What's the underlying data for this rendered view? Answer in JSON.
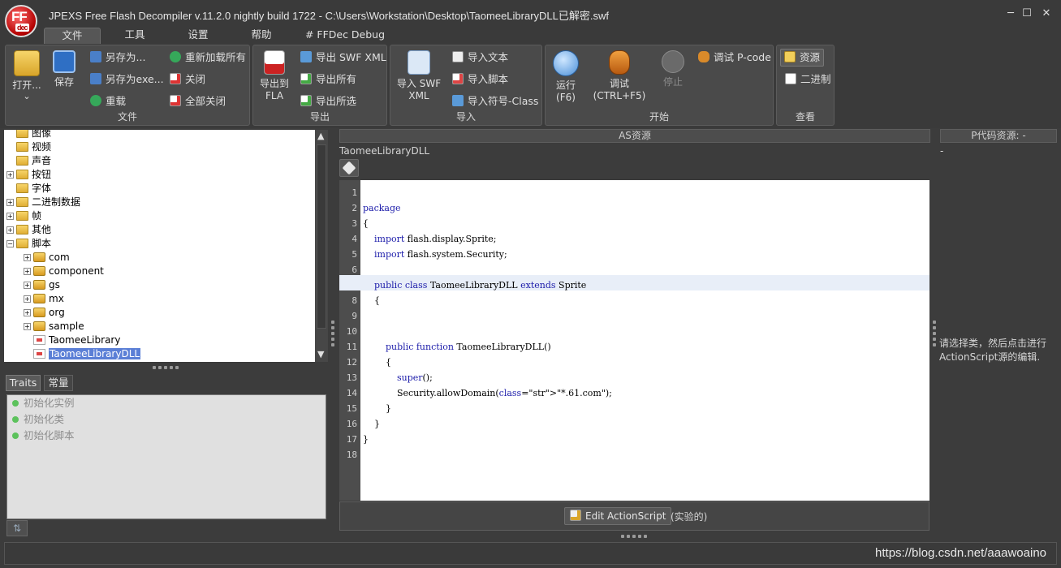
{
  "window": {
    "logo_text_top": "FF",
    "logo_text_bottom": "dec",
    "title": "JPEXS Free Flash Decompiler v.11.2.0 nightly build 1722 - C:\\Users\\Workstation\\Desktop\\TaomeeLibraryDLL已解密.swf",
    "minimize": "─",
    "maximize": "☐",
    "close": "✕"
  },
  "menu": {
    "tabs": [
      {
        "label": "文件",
        "active": true
      },
      {
        "label": "工具"
      },
      {
        "label": "设置"
      },
      {
        "label": "帮助"
      },
      {
        "label": "# FFDec Debug #"
      }
    ]
  },
  "ribbon": {
    "file": {
      "caption": "文件",
      "open": "打开...",
      "open_arrow": "⌄",
      "save": "保存",
      "save_as": "另存为...",
      "save_as_exe": "另存为exe...",
      "reload": "重载",
      "reload_all": "重新加载所有",
      "close": "关闭",
      "close_all": "全部关闭"
    },
    "export": {
      "caption": "导出",
      "export_fla_line1": "导出到",
      "export_fla_line2": "FLA",
      "export_swf_xml": "导出 SWF XML",
      "export_all": "导出所有",
      "export_selected": "导出所选"
    },
    "import": {
      "caption": "导入",
      "import_swf_xml_line1": "导入 SWF",
      "import_swf_xml_line2": "XML",
      "import_text": "导入文本",
      "import_script": "导入脚本",
      "import_symbol_class": "导入符号-Class"
    },
    "start": {
      "caption": "开始",
      "run_line1": "运行",
      "run_line2": "(F6)",
      "debug_line1": "调试",
      "debug_line2": "(CTRL+F5)",
      "stop": "停止",
      "debug_pcode": "调试 P-code"
    },
    "view": {
      "caption": "查看",
      "resources": "资源",
      "binary": "二进制"
    }
  },
  "tree": {
    "items": [
      {
        "label": "图像",
        "depth": 1,
        "expander": ""
      },
      {
        "label": "视频",
        "depth": 1,
        "expander": ""
      },
      {
        "label": "声音",
        "depth": 1,
        "expander": ""
      },
      {
        "label": "按钮",
        "depth": 1,
        "expander": "+"
      },
      {
        "label": "字体",
        "depth": 1,
        "expander": ""
      },
      {
        "label": "二进制数据",
        "depth": 1,
        "expander": "+"
      },
      {
        "label": "帧",
        "depth": 1,
        "expander": "+"
      },
      {
        "label": "其他",
        "depth": 1,
        "expander": "+"
      },
      {
        "label": "脚本",
        "depth": 1,
        "expander": "−"
      },
      {
        "label": "com",
        "depth": 2,
        "expander": "+"
      },
      {
        "label": "component",
        "depth": 2,
        "expander": "+"
      },
      {
        "label": "gs",
        "depth": 2,
        "expander": "+"
      },
      {
        "label": "mx",
        "depth": 2,
        "expander": "+"
      },
      {
        "label": "org",
        "depth": 2,
        "expander": "+"
      },
      {
        "label": "sample",
        "depth": 2,
        "expander": "+"
      },
      {
        "label": "TaomeeLibrary",
        "depth": 2,
        "expander": ""
      },
      {
        "label": "TaomeeLibraryDLL",
        "depth": 2,
        "expander": "",
        "selected": true
      }
    ]
  },
  "bottom_tabs": {
    "traits": "Traits",
    "constants": "常量"
  },
  "traits": [
    "初始化实例",
    "初始化类",
    "初始化脚本"
  ],
  "sort_icon": "⇅",
  "as_panel": {
    "header": "AS资源",
    "class_name": "TaomeeLibraryDLL",
    "code_lines": [
      "",
      "package",
      "{",
      "    import flash.display.Sprite;",
      "    import flash.system.Security;",
      "",
      "    public class TaomeeLibraryDLL extends Sprite",
      "    {",
      "",
      "",
      "        public function TaomeeLibraryDLL()",
      "        {",
      "            super();",
      "            Security.allowDomain(\"*.61.com\");",
      "        }",
      "    }",
      "}",
      ""
    ],
    "edit_button": "Edit ActionScript",
    "edit_note": "(实验的)"
  },
  "pcode_panel": {
    "header": "P代码资源: -",
    "dash": "-",
    "hint": "请选择类，然后点击进行ActionScript源的编辑."
  },
  "watermark": "https://blog.csdn.net/aaawoaino"
}
